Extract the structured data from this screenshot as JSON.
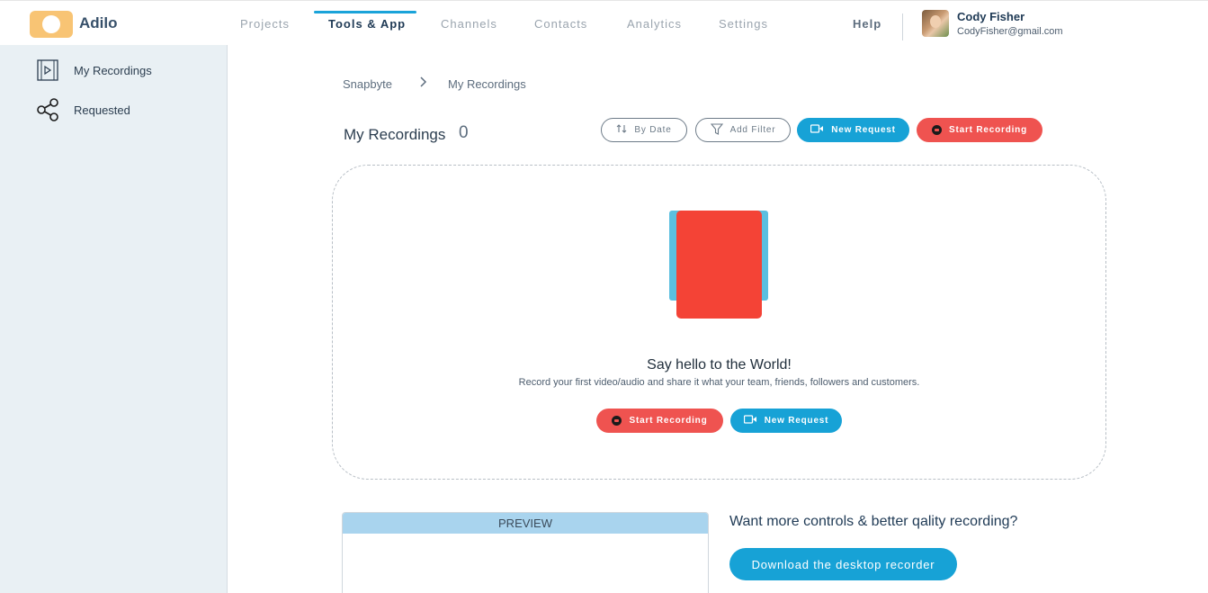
{
  "app": {
    "name": "Adilo"
  },
  "nav": {
    "items": [
      {
        "label": "Projects"
      },
      {
        "label": "Tools & App"
      },
      {
        "label": "Channels"
      },
      {
        "label": "Contacts"
      },
      {
        "label": "Analytics"
      },
      {
        "label": "Settings"
      }
    ],
    "active": "Tools & App",
    "help": "Help"
  },
  "user": {
    "name": "Cody Fisher",
    "email": "CodyFisher@gmail.com"
  },
  "sidebar": {
    "items": [
      {
        "label": "My Recordings",
        "icon": "video-file-icon"
      },
      {
        "label": "Requested",
        "icon": "share-icon"
      }
    ]
  },
  "breadcrumb": {
    "root": "Snapbyte",
    "current": "My Recordings"
  },
  "header": {
    "title": "My Recordings",
    "count": "0"
  },
  "toolbar": {
    "by_date": "By Date",
    "add_filter": "Add Filter",
    "new_request": "New Request",
    "start_recording": "Start Recording"
  },
  "empty_state": {
    "title": "Say hello to the World!",
    "subtitle": "Record your first video/audio and share it what your team, friends, followers and customers.",
    "start_recording": "Start Recording",
    "new_request": "New Request"
  },
  "preview": {
    "label": "PREVIEW"
  },
  "cta": {
    "title": "Want more controls & better qality recording?",
    "button": "Download the desktop recorder"
  },
  "colors": {
    "accent": "#17a2d6",
    "record": "#ef5350",
    "logo": "#f8c474"
  }
}
